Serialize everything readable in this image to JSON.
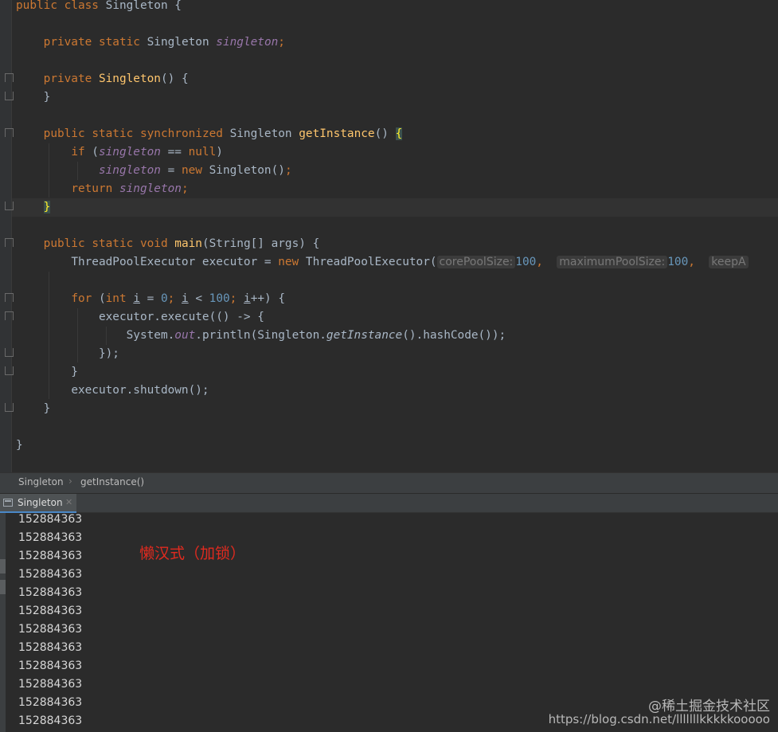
{
  "editor": {
    "tokens": {
      "public": "public",
      "class": "class",
      "private": "private",
      "static": "static",
      "synchronized": "synchronized",
      "void": "void",
      "if": "if",
      "new": "new",
      "return": "return",
      "for": "for",
      "int": "int",
      "null": "null",
      "class_name": "Singleton",
      "field_name": "singleton",
      "ctor_name": "Singleton",
      "get_instance": "getInstance",
      "main": "main",
      "string_args": "String[] args",
      "executor_decl": "ThreadPoolExecutor executor = ",
      "executor_ctor": "ThreadPoolExecutor(",
      "hint_core": "corePoolSize:",
      "hint_max": "maximumPoolSize:",
      "hint_keep": "keepA",
      "num_100": "100",
      "num_0": "0",
      "var_i": "i",
      "executor_execute": "executor.execute(() -> {",
      "system": "System.",
      "out": "out",
      "println": ".println(Singleton.",
      "hashcode": "().hashCode());",
      "close_paren": "});",
      "shutdown": "executor.shutdown();"
    }
  },
  "breadcrumb": {
    "items": [
      "Singleton",
      "getInstance()"
    ]
  },
  "run_panel": {
    "tab_label": "Singleton",
    "output": [
      "152884363",
      "152884363",
      "152884363",
      "152884363",
      "152884363",
      "152884363",
      "152884363",
      "152884363",
      "152884363",
      "152884363",
      "152884363",
      "152884363"
    ]
  },
  "annotation": "懒汉式（加锁）",
  "watermark": {
    "line1": "@稀土掘金技术社区",
    "line2": "https://blog.csdn.net/lllllllkkkkkooooo"
  },
  "colors": {
    "keyword": "#cc7832",
    "method": "#ffc66d",
    "static_field": "#9876aa",
    "number": "#6897bb",
    "text": "#a9b7c6",
    "annotation": "#e02a1f",
    "tab_accent": "#4a88c7"
  }
}
